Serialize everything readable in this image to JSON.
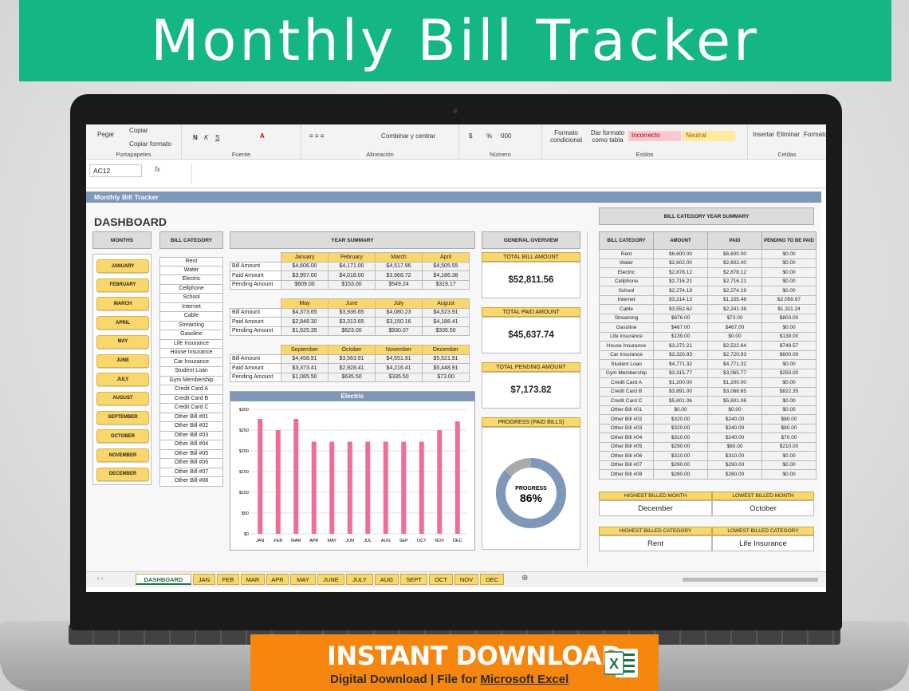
{
  "banner": {
    "title": "Monthly Bill Tracker"
  },
  "ribbon": {
    "paste": "Pegar",
    "copy": "Copiar",
    "copy_format": "Copiar formato",
    "group_clipboard": "Portapapeles",
    "bold": "N",
    "italic": "K",
    "underline": "S",
    "group_font": "Fuente",
    "merge_center": "Combinar y centrar",
    "group_alignment": "Alineación",
    "currency": "$",
    "percent": "%",
    "thousands": "000",
    "group_number": "Número",
    "cond_format": "Formato condicional",
    "format_table": "Dar formato como tabla",
    "style_bad": "Incorrecto",
    "style_neutral": "Neutral",
    "group_styles": "Estilos",
    "insert": "Insertar",
    "delete": "Eliminar",
    "format": "Formato",
    "group_cells": "Celdas"
  },
  "formula_bar": {
    "name_box": "AC12",
    "fx": "fx"
  },
  "sheet": {
    "titlebar": "Monthly Bill Tracker",
    "dashboard": "DASHBOARD",
    "months_header": "MONTHS",
    "category_header": "BILL CATEGORY",
    "year_summary_header": "YEAR SUMMARY",
    "general_overview_header": "GENERAL OVERVIEW",
    "bcys_header": "BILL CATEGORY YEAR SUMMARY",
    "months": [
      "JANUARY",
      "FEBRUARY",
      "MARCH",
      "APRIL",
      "MAY",
      "JUNE",
      "JULY",
      "AUGUST",
      "SEPTEMBER",
      "OCTOBER",
      "NOVEMBER",
      "DECEMBER"
    ],
    "categories": [
      "Rent",
      "Water",
      "Electric",
      "Cellphone",
      "School",
      "Internet",
      "Cable",
      "Streaming",
      "Gasoline",
      "Life Insurance",
      "House Insurance",
      "Car Insurance",
      "Student Loan",
      "Gym Membership",
      "Credit Card A",
      "Credit Card B",
      "Credit Card C",
      "Other Bill #01",
      "Other Bill #02",
      "Other Bill #03",
      "Other Bill #04",
      "Other Bill #05",
      "Other Bill #06",
      "Other Bill #07",
      "Other Bill #08"
    ],
    "row_labels": [
      "Bill Amount",
      "Paid Amount",
      "Pending Amount"
    ],
    "quarters": [
      {
        "months": [
          "January",
          "February",
          "March",
          "April"
        ],
        "bill": [
          "$4,606.00",
          "$4,171.00",
          "$4,517.96",
          "$4,505.55"
        ],
        "paid": [
          "$3,997.00",
          "$4,018.00",
          "$3,968.72",
          "$4,186.38"
        ],
        "pending": [
          "$609.00",
          "$153.00",
          "$549.24",
          "$319.17"
        ]
      },
      {
        "months": [
          "May",
          "June",
          "July",
          "August"
        ],
        "bill": [
          "$4,373.65",
          "$3,936.65",
          "$4,080.23",
          "$4,523.91"
        ],
        "paid": [
          "$2,848.30",
          "$3,313.65",
          "$3,150.16",
          "$4,188.41"
        ],
        "pending": [
          "$1,525.35",
          "$623.00",
          "$930.07",
          "$335.50"
        ]
      },
      {
        "months": [
          "September",
          "October",
          "November",
          "December"
        ],
        "bill": [
          "$4,458.91",
          "$3,563.91",
          "$4,551.91",
          "$5,521.91"
        ],
        "paid": [
          "$3,373.41",
          "$2,928.41",
          "$4,216.41",
          "$5,448.91"
        ],
        "pending": [
          "$1,085.50",
          "$635.50",
          "$335.50",
          "$73.00"
        ]
      }
    ],
    "overview": {
      "total_bill_label": "TOTAL BILL AMOUNT",
      "total_bill": "$52,811.56",
      "total_paid_label": "TOTAL PAID AMOUNT",
      "total_paid": "$45,637.74",
      "total_pending_label": "TOTAL PENDING AMOUNT",
      "total_pending": "$7,173.82",
      "progress_label": "PROGRESS (PAID BILLS)",
      "progress_word": "PROGRESS",
      "progress_value": "86%",
      "progress_fraction": 0.86
    },
    "bcys": {
      "headers": [
        "BILL CATEGORY",
        "AMOUNT",
        "PAID",
        "PENDING TO BE PAID"
      ],
      "rows": [
        [
          "Rent",
          "$6,600.00",
          "$6,600.00",
          "$0.00"
        ],
        [
          "Water",
          "$2,602.00",
          "$2,602.00",
          "$0.00"
        ],
        [
          "Electric",
          "$2,878.12",
          "$2,878.12",
          "$0.00"
        ],
        [
          "Cellphone",
          "$2,716.21",
          "$2,716.21",
          "$0.00"
        ],
        [
          "School",
          "$2,274.19",
          "$2,274.19",
          "$0.00"
        ],
        [
          "Internet",
          "$3,214.13",
          "$1,155.46",
          "$2,058.67"
        ],
        [
          "Cable",
          "$3,552.62",
          "$2,241.38",
          "$1,311.24"
        ],
        [
          "Streaming",
          "$876.00",
          "$73.00",
          "$803.00"
        ],
        [
          "Gasoline",
          "$467.00",
          "$467.00",
          "$0.00"
        ],
        [
          "Life Insurance",
          "$139.00",
          "$0.00",
          "$139.00"
        ],
        [
          "House Insurance",
          "$3,272.21",
          "$2,522.64",
          "$749.57"
        ],
        [
          "Car Insurance",
          "$3,320.93",
          "$2,720.93",
          "$600.00"
        ],
        [
          "Student Loan",
          "$4,771.32",
          "$4,771.32",
          "$0.00"
        ],
        [
          "Gym Membership",
          "$3,315.77",
          "$3,065.77",
          "$250.00"
        ],
        [
          "Credit Card A",
          "$1,200.00",
          "$1,200.00",
          "$0.00"
        ],
        [
          "Credit Card B",
          "$3,891.00",
          "$3,068.65",
          "$822.35"
        ],
        [
          "Credit Card C",
          "$5,601.06",
          "$5,601.06",
          "$0.00"
        ],
        [
          "Other Bill #01",
          "$0.00",
          "$0.00",
          "$0.00"
        ],
        [
          "Other Bill #02",
          "$320.00",
          "$240.00",
          "$80.00"
        ],
        [
          "Other Bill #03",
          "$320.00",
          "$240.00",
          "$80.00"
        ],
        [
          "Other Bill #04",
          "$310.00",
          "$240.00",
          "$70.00"
        ],
        [
          "Other Bill #05",
          "$290.00",
          "$80.00",
          "$210.00"
        ],
        [
          "Other Bill #06",
          "$310.00",
          "$310.00",
          "$0.00"
        ],
        [
          "Other Bill #07",
          "$290.00",
          "$290.00",
          "$0.00"
        ],
        [
          "Other Bill #08",
          "$280.00",
          "$280.00",
          "$0.00"
        ]
      ]
    },
    "highlights": {
      "highest_month_label": "HIGHEST BILLED MONTH",
      "highest_month": "December",
      "lowest_month_label": "LOWEST BILLED MONTH",
      "lowest_month": "October",
      "highest_cat_label": "HIGHEST BILLED CATEGORY",
      "highest_cat": "Rent",
      "lowest_cat_label": "LOWEST BILLED CATEGORY",
      "lowest_cat": "Life Insurance"
    }
  },
  "tabs": [
    "DASHBOARD",
    "JAN",
    "FEB",
    "MAR",
    "APR",
    "MAY",
    "JUNE",
    "JULY",
    "AUG",
    "SEPT",
    "OCT",
    "NOV",
    "DEC"
  ],
  "chart_data": {
    "type": "bar",
    "title": "Electric",
    "categories": [
      "JAN",
      "FEB",
      "MAR",
      "APR",
      "MAY",
      "JUN",
      "JUL",
      "AUG",
      "SEP",
      "OCT",
      "NOV",
      "DEC"
    ],
    "values": [
      277,
      250,
      277,
      222,
      222,
      222,
      222,
      222,
      222,
      222,
      250,
      271
    ],
    "ylim": [
      0,
      300
    ],
    "yticks": [
      "$0",
      "$50",
      "$100",
      "$150",
      "$200",
      "$250",
      "$300"
    ],
    "grid": true,
    "bar_color": "#f06c9b"
  },
  "download": {
    "title": "INSTANT DOWNLOAD",
    "sub_prefix": "Digital Download | File for ",
    "sub_brand": "Microsoft Excel",
    "icon_letter": "X"
  },
  "colors": {
    "banner": "#14b784",
    "accent": "#f9d76a",
    "titlebar": "#7f97b8",
    "download": "#f5860f",
    "excel": "#217346"
  }
}
